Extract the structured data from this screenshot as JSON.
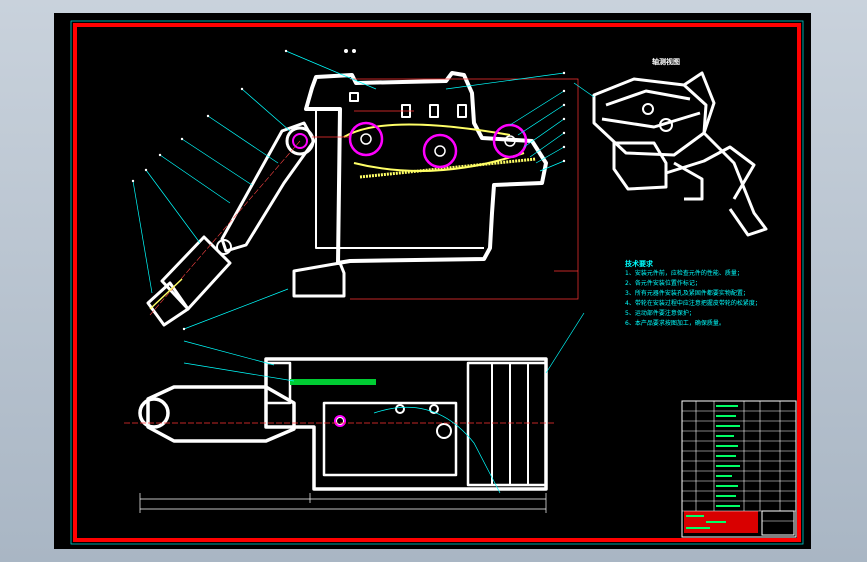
{
  "drawing": {
    "colors": {
      "background": "#000000",
      "outer_frame": "#ff0000",
      "outline": "#ffffff",
      "leaders": "#00ffff",
      "gears": "#ff00ff",
      "belt": "#ffff66",
      "hatch": "#00cc33"
    },
    "axonometric_view_label": "轴测视图",
    "technical_requirements": {
      "heading": "技术要求",
      "items": [
        "1、安装元件前，应检查元件的性能、质量；",
        "2、各元件安装位置作标记；",
        "3、所有元器件安装孔及紧固件都要实物配置；",
        "4、带轮在安装过程中应注意把握皮带轮的松紧度；",
        "5、运动部件要注意保护；",
        "6、本产品要求按图加工，确保质量。"
      ]
    }
  }
}
